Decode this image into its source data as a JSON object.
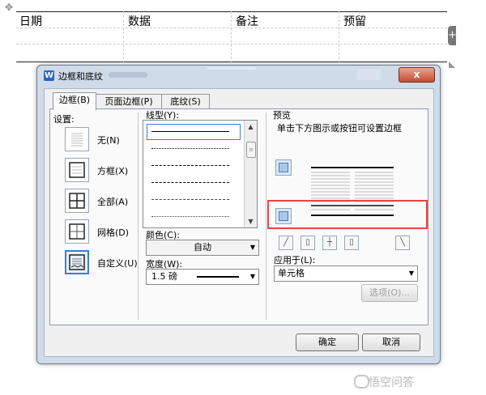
{
  "doc_table": {
    "move_handle": "✥",
    "headers": [
      "日期",
      "数据",
      "备注",
      "预留"
    ],
    "add_column": "+"
  },
  "dialog": {
    "app_icon": "W",
    "title": "边框和底纹",
    "close": "x",
    "tabs": [
      "边框(B)",
      "页面边框(P)",
      "底纹(S)"
    ],
    "settings": {
      "label": "设置:",
      "items": [
        "无(N)",
        "方框(X)",
        "全部(A)",
        "网格(D)",
        "自定义(U)"
      ],
      "selected": "自定义(U)"
    },
    "line_style": {
      "label": "线型(Y):",
      "items": [
        "solid",
        "dotted",
        "dashed",
        "dash-dot",
        "long-dash",
        "dash-dot-dot"
      ]
    },
    "color": {
      "label": "颜色(C):",
      "value": "自动"
    },
    "width": {
      "label": "宽度(W):",
      "value": "1.5 磅"
    },
    "preview": {
      "label": "预览",
      "hint": "单击下方图示或按钮可设置边框"
    },
    "apply_to": {
      "label": "应用于(L):",
      "value": "单元格"
    },
    "options_button": "选项(O)...",
    "ok_button": "确定",
    "cancel_button": "取消"
  },
  "watermark": "悟空问答",
  "colors": {
    "dialog_frame": "#cfdbe9",
    "highlight_red": "#e54545",
    "close_red": "#c74a33",
    "selection_blue": "#3c7fd1"
  }
}
